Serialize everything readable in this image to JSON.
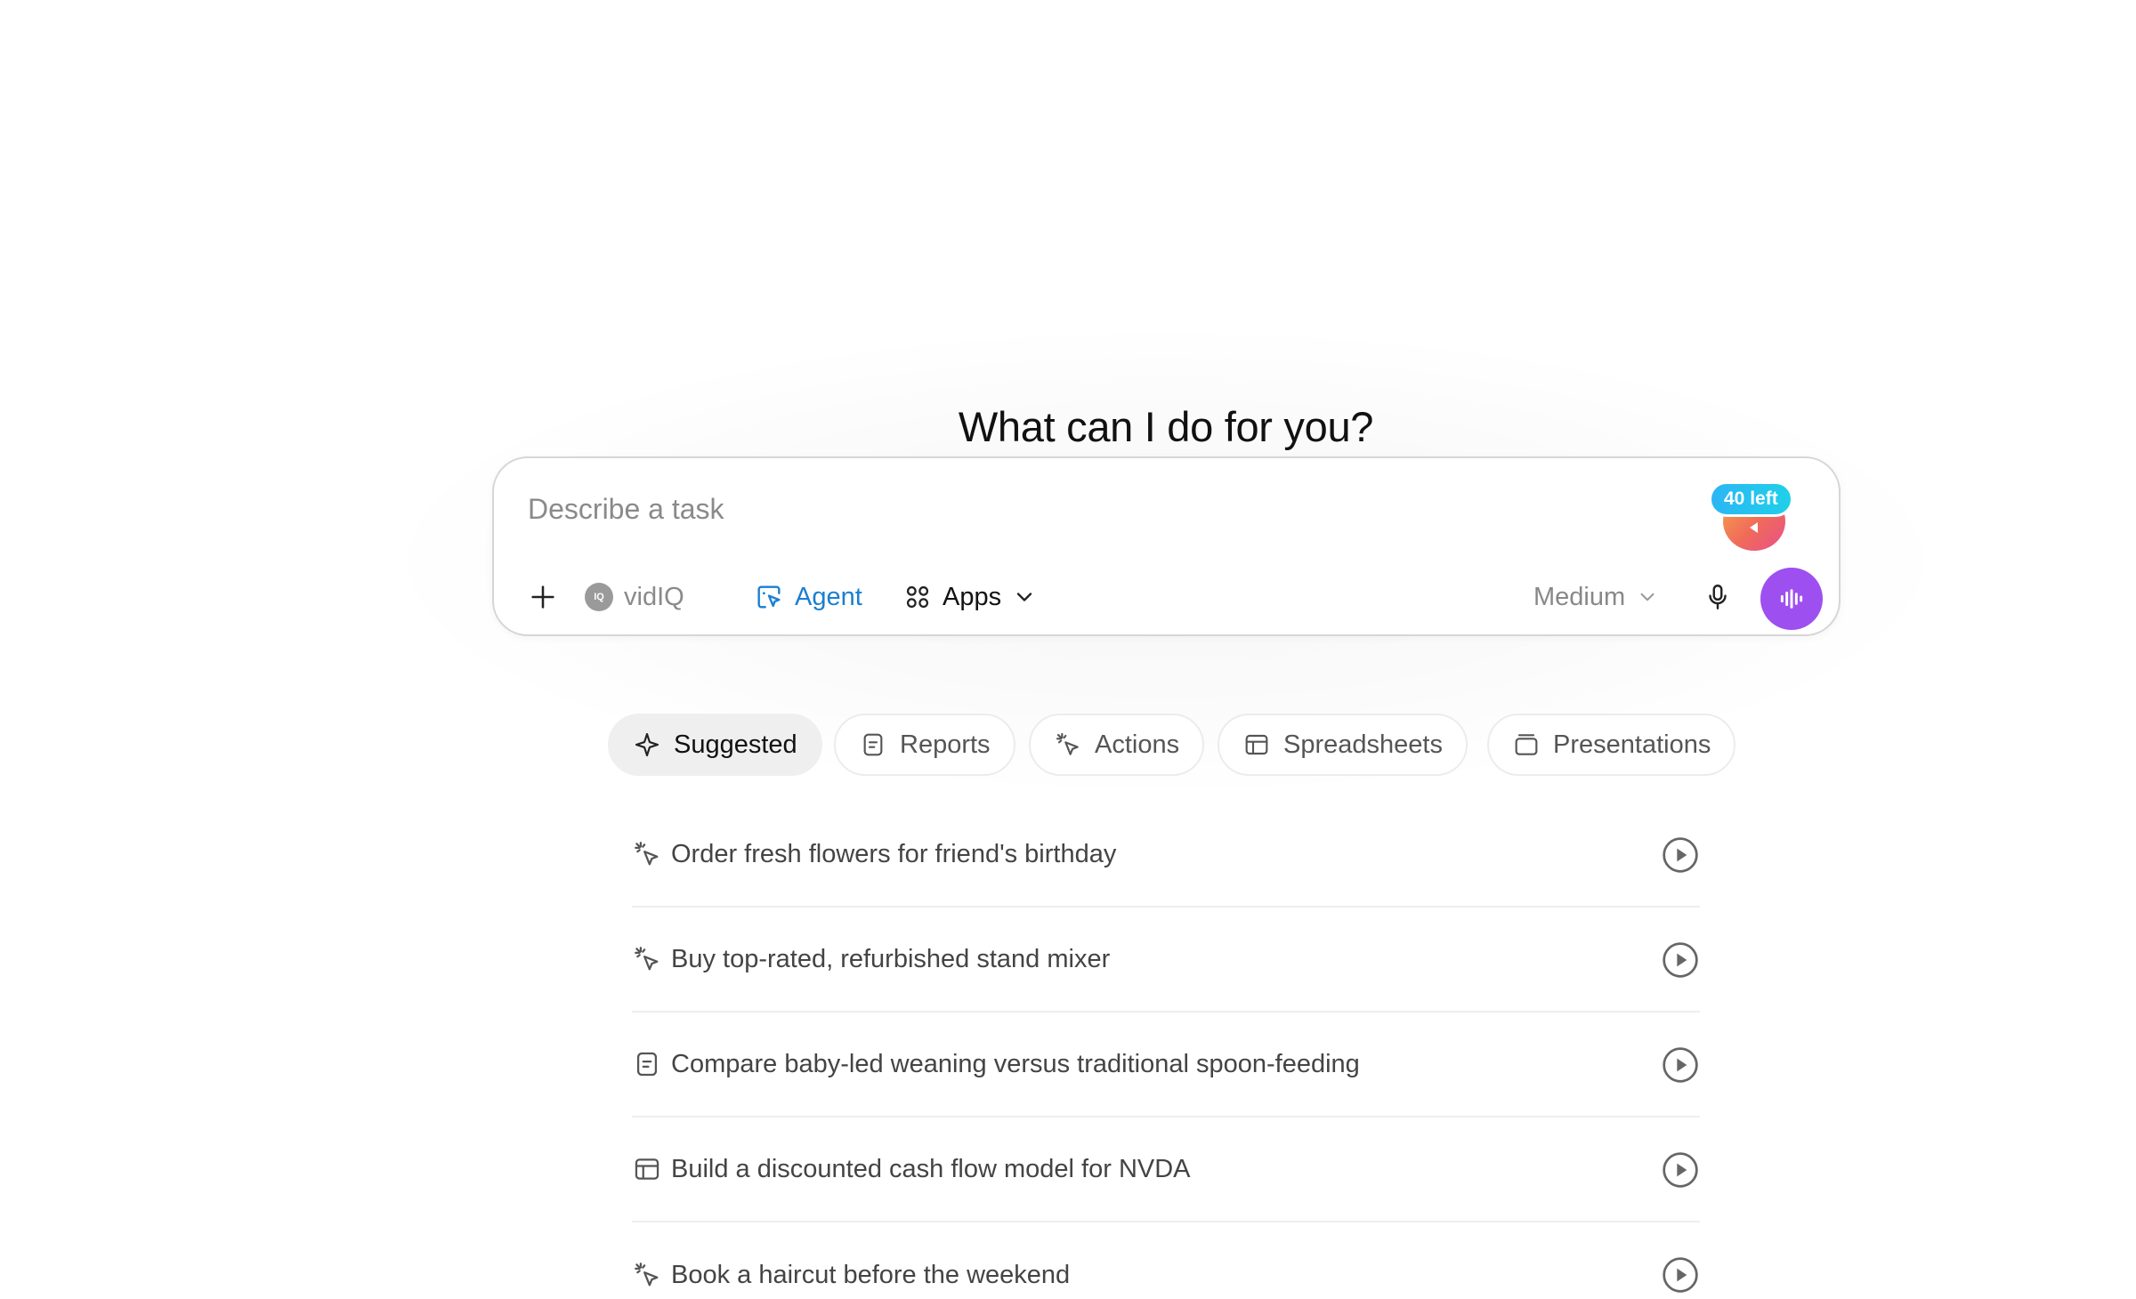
{
  "heading": "What can I do for you?",
  "composer": {
    "placeholder": "Describe a task",
    "credits_label": "40 left",
    "vidiq_label": "vidIQ",
    "vidiq_logo_text": "IQ",
    "agent_label": "Agent",
    "apps_label": "Apps",
    "model_label": "Medium"
  },
  "colors": {
    "agent_accent": "#1a7fd1",
    "voice_button": "#9e4ff0",
    "credits_pill": "#2bb6f5"
  },
  "tabs": [
    {
      "label": "Suggested",
      "icon": "sparkle-icon",
      "active": true
    },
    {
      "label": "Reports",
      "icon": "document-icon",
      "active": false
    },
    {
      "label": "Actions",
      "icon": "cursor-click-icon",
      "active": false
    },
    {
      "label": "Spreadsheets",
      "icon": "table-icon",
      "active": false
    },
    {
      "label": "Presentations",
      "icon": "slides-icon",
      "active": false
    }
  ],
  "suggestions": [
    {
      "text": "Order fresh flowers for friend's birthday",
      "icon": "cursor-click-icon"
    },
    {
      "text": "Buy top-rated, refurbished stand mixer",
      "icon": "cursor-click-icon"
    },
    {
      "text": "Compare baby-led weaning versus traditional spoon-feeding",
      "icon": "document-icon"
    },
    {
      "text": "Build a discounted cash flow model for NVDA",
      "icon": "table-icon"
    },
    {
      "text": "Book a haircut before the weekend",
      "icon": "cursor-click-icon"
    }
  ]
}
